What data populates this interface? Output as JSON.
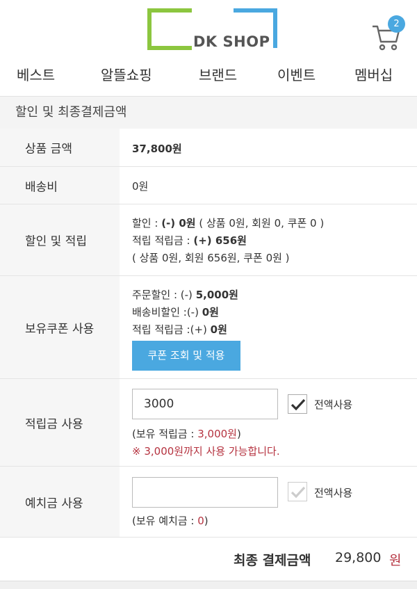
{
  "brand": {
    "logo_text": "DK SHOP",
    "accent_green": "#8cc63f",
    "accent_blue": "#4aa8e0"
  },
  "cart": {
    "icon": "cart-icon",
    "count": "2"
  },
  "nav": {
    "items": [
      "베스트",
      "알뜰쇼핑",
      "브랜드",
      "이벤트",
      "멤버십"
    ]
  },
  "section": {
    "title": "할인 및 최종결제금액"
  },
  "rows": {
    "product_amount": {
      "label": "상품 금액",
      "value": "37,800원"
    },
    "shipping": {
      "label": "배송비",
      "value": "0원"
    },
    "discount": {
      "label": "할인 및 적립",
      "line1_prefix": "할인 : ",
      "line1_bold": "(-) 0원",
      "line1_suffix": " ( 상품 0원, 회원 0, 쿠폰 0 )",
      "line2_prefix": "적립 적립금 : ",
      "line2_bold": "(+) 656원",
      "line3": "( 상품 0원, 회원 656원, 쿠폰 0원 )"
    },
    "coupon": {
      "label": "보유쿠폰 사용",
      "order_discount_prefix": "주문할인 : (-) ",
      "order_discount_value": "5,000원",
      "ship_discount_prefix": "배송비할인 :(-) ",
      "ship_discount_value": "0원",
      "points_prefix": "적립 적립금 :(+) ",
      "points_value": "0원",
      "button_label": "쿠폰 조회 및 적용"
    },
    "points": {
      "label": "적립금 사용",
      "input_value": "3000",
      "checkbox_label": "전액사용",
      "checked": true,
      "held_prefix": "(보유 적립금 : ",
      "held_value": "3,000원",
      "held_suffix": ")",
      "notice": "※ 3,000원까지 사용 가능합니다."
    },
    "deposit": {
      "label": "예치금 사용",
      "input_value": "",
      "checkbox_label": "전액사용",
      "checked": false,
      "held_prefix": "(보유 예치금 : ",
      "held_value": "0",
      "held_suffix": ")"
    }
  },
  "total": {
    "label": "최종 결제금액",
    "amount": "29,800",
    "unit": "원"
  },
  "colors": {
    "red": "#b5323f",
    "table_header_bg": "#f6f6f6"
  }
}
